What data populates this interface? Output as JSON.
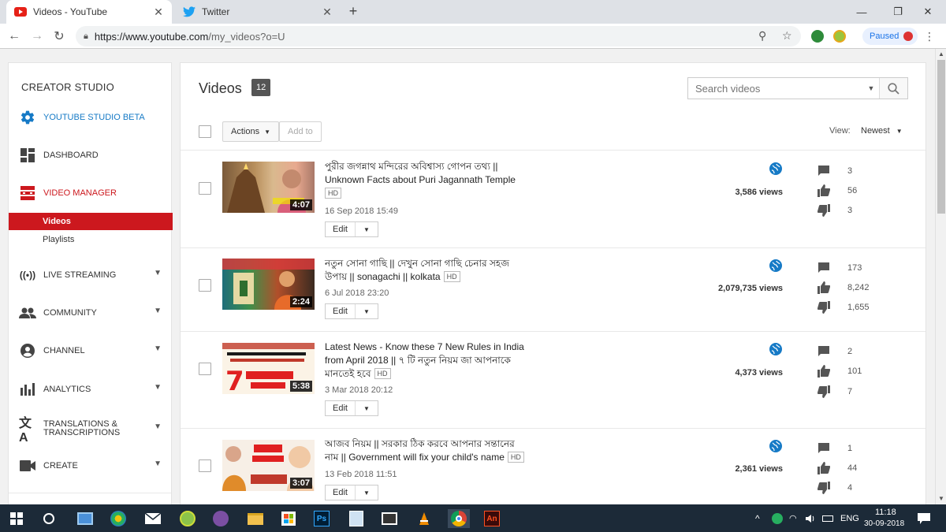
{
  "browser": {
    "tabs": [
      {
        "title": "Videos - YouTube",
        "icon": "youtube-icon",
        "active": true
      },
      {
        "title": "Twitter",
        "icon": "twitter-icon",
        "active": false
      }
    ],
    "url_host": "https://www.youtube.com",
    "url_path": "/my_videos?o=U",
    "profile_status": "Paused"
  },
  "sidebar": {
    "header": "CREATOR STUDIO",
    "studio_beta": "YOUTUBE STUDIO BETA",
    "dashboard": "DASHBOARD",
    "video_manager": "VIDEO MANAGER",
    "sub_videos": "Videos",
    "sub_playlists": "Playlists",
    "live_streaming": "LIVE STREAMING",
    "community": "COMMUNITY",
    "channel": "CHANNEL",
    "analytics": "ANALYTICS",
    "translations_line1": "TRANSLATIONS &",
    "translations_line2": "TRANSCRIPTIONS",
    "create": "CREATE"
  },
  "main": {
    "title": "Videos",
    "count": "12",
    "search_placeholder": "Search videos",
    "actions_label": "Actions",
    "add_to_label": "Add to",
    "view_label": "View:",
    "view_value": "Newest",
    "edit_label": "Edit",
    "hd_label": "HD",
    "videos": [
      {
        "title_line1": "পুরীর জগন্নাথ মন্দিরের অবিশ্বাস্য গোপন তথ্য ||",
        "title_line2": "Unknown Facts about Puri Jagannath Temple",
        "date": "16 Sep 2018 15:49",
        "duration": "4:07",
        "views": "3,586 views",
        "comments": "3",
        "likes": "56",
        "dislikes": "3"
      },
      {
        "title_line1": "নতুন সোনা গাছি || দেখুন সোনা গাছি চেনার সহজ",
        "title_line2": "উপায় || sonagachi || kolkata",
        "date": "6 Jul 2018 23:20",
        "duration": "2:24",
        "views": "2,079,735 views",
        "comments": "173",
        "likes": "8,242",
        "dislikes": "1,655"
      },
      {
        "title_line1": "Latest News - Know these 7 New Rules in India",
        "title_line2": "from April 2018 || ৭ টি নতুন নিয়ম জা আপনাকে",
        "title_line3": "মানতেই হবে",
        "date": "3 Mar 2018 20:12",
        "duration": "5:38",
        "views": "4,373 views",
        "comments": "2",
        "likes": "101",
        "dislikes": "7"
      },
      {
        "title_line1": "আজব নিয়ম || সরকার ঠিক করবে আপনার সন্তানের",
        "title_line2": "নাম || Government will fix your child's name",
        "date": "13 Feb 2018 11:51",
        "duration": "3:07",
        "views": "2,361 views",
        "comments": "1",
        "likes": "44",
        "dislikes": "4"
      }
    ]
  },
  "taskbar": {
    "language": "ENG",
    "time": "11:18",
    "date": "30-09-2018"
  },
  "colors": {
    "accent_red": "#cc181e",
    "link_blue": "#167ac6",
    "taskbar": "#1c2a38"
  }
}
